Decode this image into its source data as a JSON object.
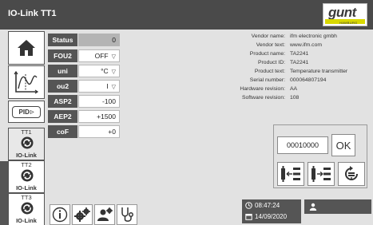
{
  "window": {
    "title": "IO-Link TT1"
  },
  "logo": {
    "brand": "gunt",
    "sub": "HAMBURG"
  },
  "sidebar": {
    "pid_label": "PID",
    "io_buttons": [
      {
        "top": "TT1",
        "bottom": "IO-Link"
      },
      {
        "top": "TT2",
        "bottom": "IO-Link"
      },
      {
        "top": "TT3",
        "bottom": "IO-Link"
      }
    ]
  },
  "params": [
    {
      "label": "Status",
      "value": "0"
    },
    {
      "label": "FOU2",
      "value": "OFF"
    },
    {
      "label": "uni",
      "value": "°C"
    },
    {
      "label": "ou2",
      "value": "I"
    },
    {
      "label": "ASP2",
      "value": "-100"
    },
    {
      "label": "AEP2",
      "value": "+1500"
    },
    {
      "label": "coF",
      "value": "+0"
    }
  ],
  "device_info": [
    {
      "key": "Vendor name:",
      "value": "ifm electronic gmbh"
    },
    {
      "key": "Vendor text:",
      "value": "www.ifm.com"
    },
    {
      "key": "Product name:",
      "value": "TA2241"
    },
    {
      "key": "Product ID:",
      "value": "TA2241"
    },
    {
      "key": "Product text:",
      "value": "Temperature transmitter"
    },
    {
      "key": "Serial number:",
      "value": "000064807194"
    },
    {
      "key": "Hardware revision:",
      "value": "AA"
    },
    {
      "key": "Software revision:",
      "value": "108"
    }
  ],
  "panel": {
    "code": "00010000",
    "ok_label": "OK"
  },
  "status": {
    "time": "08:47:24",
    "date": "14/09/2020"
  },
  "colors": {
    "titlebar": "#4a4a4a",
    "label_bg": "#555555",
    "background": "#e2e2e2",
    "accent": "#d8d800"
  },
  "icons": [
    "home-icon",
    "trend-chart-icon",
    "refresh-icon",
    "info-icon",
    "settings-icon",
    "user-settings-icon",
    "stethoscope-icon",
    "clock-icon",
    "calendar-icon",
    "user-icon",
    "download-device-icon",
    "upload-device-icon",
    "reset-icon"
  ]
}
